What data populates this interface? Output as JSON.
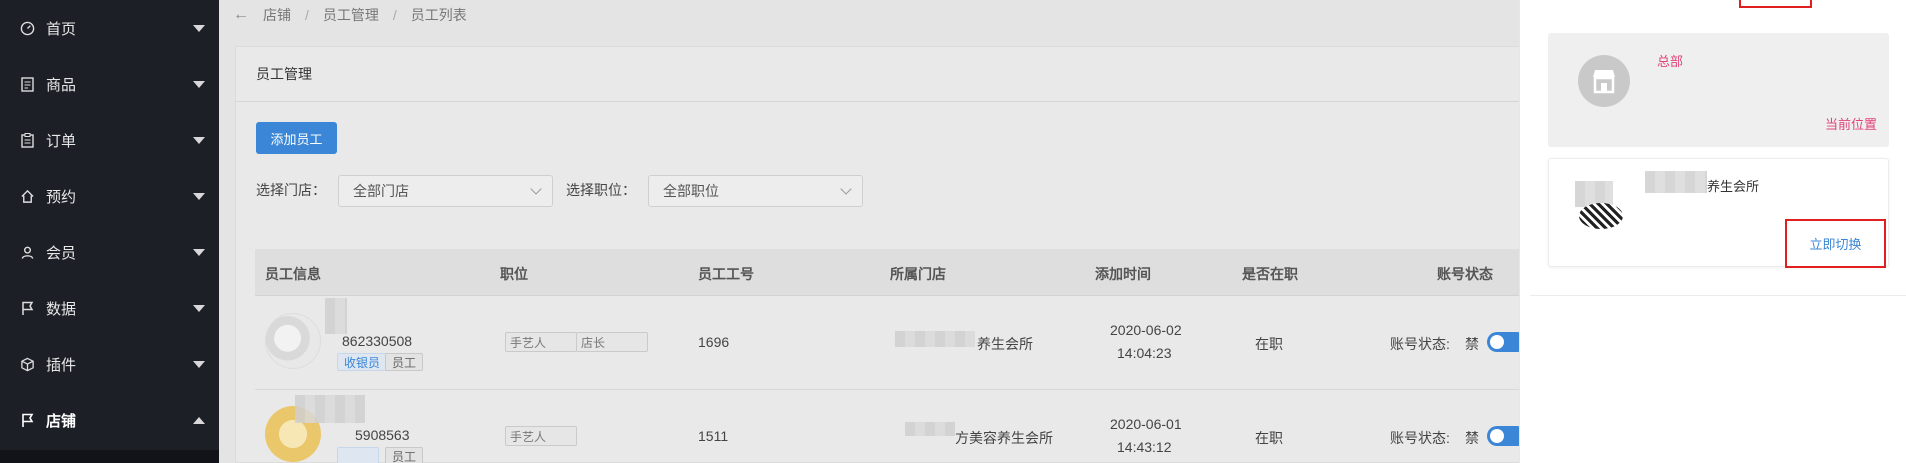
{
  "sidebar": {
    "items": [
      {
        "label": "首页",
        "icon": "dashboard-icon"
      },
      {
        "label": "商品",
        "icon": "document-icon"
      },
      {
        "label": "订单",
        "icon": "clipboard-icon"
      },
      {
        "label": "预约",
        "icon": "home-icon"
      },
      {
        "label": "会员",
        "icon": "user-icon"
      },
      {
        "label": "数据",
        "icon": "flag-icon"
      },
      {
        "label": "插件",
        "icon": "cube-icon"
      },
      {
        "label": "店铺",
        "icon": "flag-icon",
        "expanded": true
      }
    ]
  },
  "breadcrumb": {
    "items": [
      "店铺",
      "员工管理",
      "员工列表"
    ]
  },
  "card": {
    "title": "员工管理",
    "add_button": "添加员工",
    "filters": {
      "store_label": "选择门店：",
      "store_value": "全部门店",
      "position_label": "选择职位：",
      "position_value": "全部职位"
    },
    "columns": [
      "员工信息",
      "职位",
      "员工工号",
      "所属门店",
      "添加时间",
      "是否在职",
      "账号状态"
    ],
    "rows": [
      {
        "phone": "862330508",
        "tags": [
          "收银员",
          "员工"
        ],
        "roles": [
          "手艺人",
          "店长"
        ],
        "employee_no": "1696",
        "store": "养生会所",
        "date": "2020-06-02",
        "time": "14:04:23",
        "employment": "在职",
        "status_label": "账号状态:",
        "status_text": "禁",
        "enabled": true
      },
      {
        "phone": "5908563",
        "tags": [
          "",
          "员工"
        ],
        "roles": [
          "手艺人"
        ],
        "employee_no": "1511",
        "store": "方美容养生会所",
        "date": "2020-06-01",
        "time": "14:43:12",
        "employment": "在职",
        "status_label": "账号状态:",
        "status_text": "禁",
        "enabled": true
      }
    ]
  },
  "drawer": {
    "store1": {
      "name": "总部",
      "location": "当前位置"
    },
    "store2": {
      "name": "养生会所",
      "action": "立即切换"
    }
  },
  "colors": {
    "accent": "#3b86d6",
    "pink": "#e0457a",
    "highlight": "#e02020",
    "sidebar": "#1d1f27"
  }
}
